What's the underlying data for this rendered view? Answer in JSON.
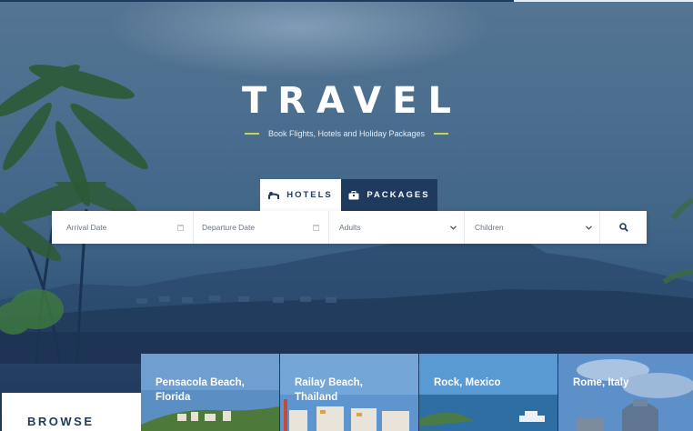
{
  "hero": {
    "title": "TRAVEL",
    "subtitle": "Book Flights, Hotels and Holiday Packages"
  },
  "tabs": [
    {
      "label": "HOTELS",
      "icon": "hotel-bed-icon",
      "active": true
    },
    {
      "label": "PACKAGES",
      "icon": "suitcase-icon",
      "active": false
    }
  ],
  "search": {
    "arrival_placeholder": "Arrival Date",
    "departure_placeholder": "Departure Date",
    "adults_placeholder": "Adults",
    "children_placeholder": "Children",
    "icons": [
      "calendar-icon",
      "chevron-down-icon",
      "search-icon"
    ]
  },
  "browse": {
    "heading": "BROWSE"
  },
  "destinations": [
    {
      "name": "Pensacola Beach, Florida"
    },
    {
      "name": "Railay Beach, Thailand"
    },
    {
      "name": "Rock, Mexico"
    },
    {
      "name": "Rome, Italy"
    }
  ],
  "colors": {
    "brand_navy": "#1e3a5f",
    "accent_lime": "#c9d34a",
    "sky_blue": "#4a6d8e"
  }
}
